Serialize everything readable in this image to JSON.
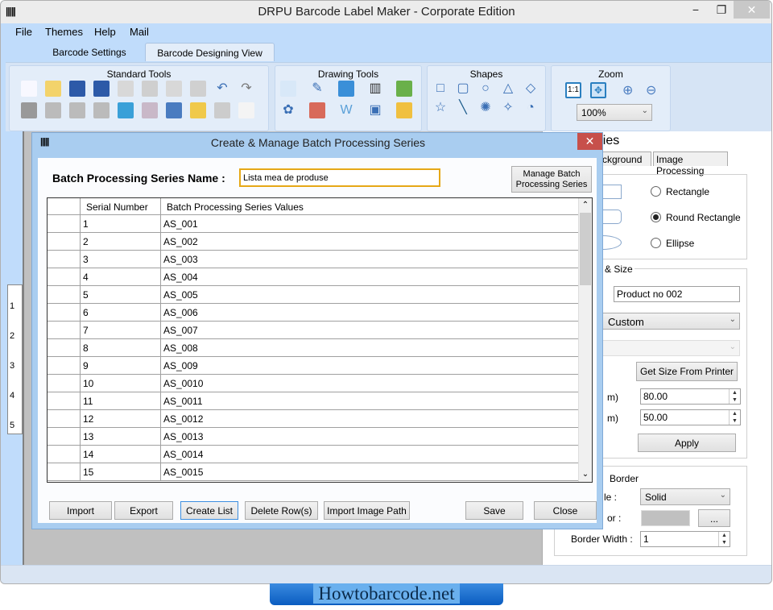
{
  "window": {
    "title": "DRPU Barcode Label Maker - Corporate Edition",
    "minimize": "−",
    "restore": "❐",
    "close": "✕"
  },
  "menu": [
    "File",
    "Themes",
    "Help",
    "Mail"
  ],
  "tabs": [
    "Barcode Settings",
    "Barcode Designing View"
  ],
  "ribbon": {
    "groups": [
      "Standard Tools",
      "Drawing Tools",
      "Shapes",
      "Zoom"
    ],
    "zoom_value": "100%",
    "zoom_one": "1:1"
  },
  "ruler": [
    "1",
    "2",
    "3",
    "4",
    "5"
  ],
  "properties": {
    "title_partial": "rties",
    "tabs": [
      "ckground",
      "Image Processing"
    ],
    "shape_options": [
      {
        "label": "Rectangle",
        "selected": false
      },
      {
        "label": "Round Rectangle",
        "selected": true
      },
      {
        "label": "Ellipse",
        "selected": false
      }
    ],
    "size_group": "e & Size",
    "name_value": "Product no 002",
    "size_select": "Custom",
    "get_size_button": "Get Size From Printer",
    "width_label": "m)",
    "width_value": "80.00",
    "height_label": "m)",
    "height_value": "50.00",
    "apply_button": "Apply",
    "border_group": "Border",
    "style_label": "le :",
    "style_value": "Solid",
    "color_label": "or :",
    "color_button": "...",
    "border_color": "#c0c0c0",
    "border_width_label": "Border Width :",
    "border_width_value": "1"
  },
  "dialog": {
    "title": "Create & Manage Batch Processing Series",
    "close": "✕",
    "name_label": "Batch Processing Series Name :",
    "name_value": "Lista mea de produse",
    "manage_button": "Manage  Batch Processing Series",
    "columns": [
      "Serial Number",
      "Batch Processing Series Values"
    ],
    "rows": [
      [
        "1",
        "AS_001"
      ],
      [
        "2",
        "AS_002"
      ],
      [
        "3",
        "AS_003"
      ],
      [
        "4",
        "AS_004"
      ],
      [
        "5",
        "AS_005"
      ],
      [
        "6",
        "AS_006"
      ],
      [
        "7",
        "AS_007"
      ],
      [
        "8",
        "AS_008"
      ],
      [
        "9",
        "AS_009"
      ],
      [
        "10",
        "AS_0010"
      ],
      [
        "11",
        "AS_0011"
      ],
      [
        "12",
        "AS_0012"
      ],
      [
        "13",
        "AS_0013"
      ],
      [
        "14",
        "AS_0014"
      ],
      [
        "15",
        "AS_0015"
      ]
    ],
    "buttons": {
      "import": "Import",
      "export": "Export",
      "create_list": "Create List",
      "delete_rows": "Delete Row(s)",
      "import_image_path": "Import Image Path",
      "save": "Save",
      "close": "Close"
    }
  },
  "watermark": "Howtobarcode.net"
}
